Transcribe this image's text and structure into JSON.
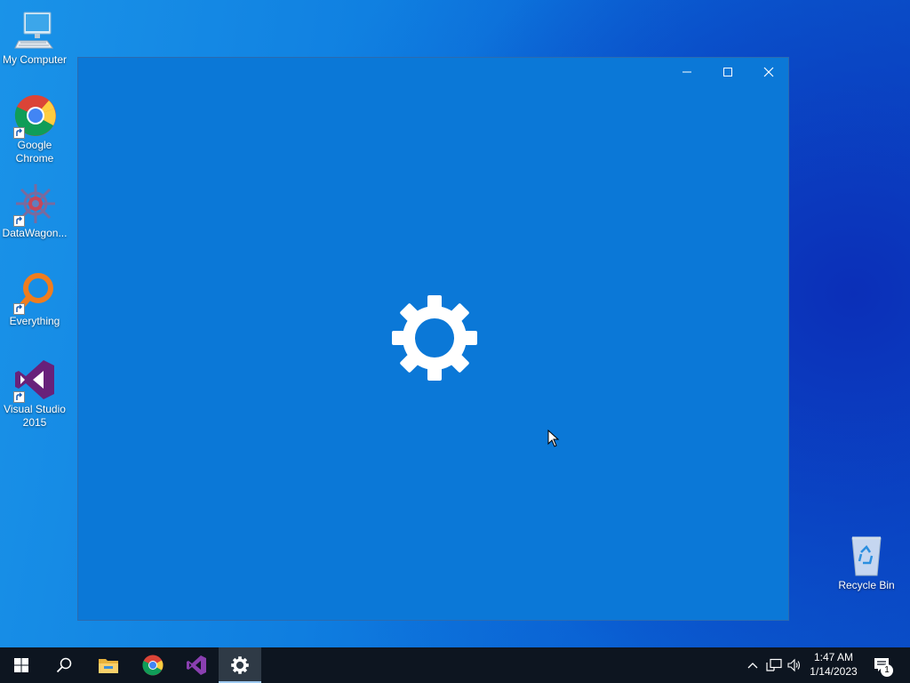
{
  "desktop": {
    "icons": [
      {
        "label": "My Computer",
        "icon": "computer-icon"
      },
      {
        "label": "Google Chrome",
        "icon": "chrome-icon"
      },
      {
        "label": "DataWagon...",
        "icon": "datawagon-icon"
      },
      {
        "label": "Everything",
        "icon": "everything-icon"
      },
      {
        "label": "Visual Studio 2015",
        "icon": "visual-studio-icon"
      },
      {
        "label": "Recycle Bin",
        "icon": "recycle-bin-icon"
      }
    ]
  },
  "window": {
    "controls": [
      "minimize-icon",
      "maximize-icon",
      "close-icon"
    ],
    "background": "#0b78d7",
    "splash_icon": "gear-icon"
  },
  "taskbar": {
    "buttons": [
      "windows-start-icon",
      "search-icon",
      "file-explorer-icon",
      "chrome-icon",
      "visual-studio-icon",
      "settings-gear-icon"
    ],
    "active_button": "settings-gear-icon",
    "tray_icons": [
      "chevron-up-icon",
      "network-icon",
      "volume-icon"
    ],
    "clock": {
      "time": "1:47 AM",
      "date": "1/14/2023"
    },
    "notifications": {
      "count": "1",
      "icon": "action-center-icon"
    }
  },
  "colors": {
    "taskbar": "#0d1520",
    "accent": "#0b78d7"
  }
}
